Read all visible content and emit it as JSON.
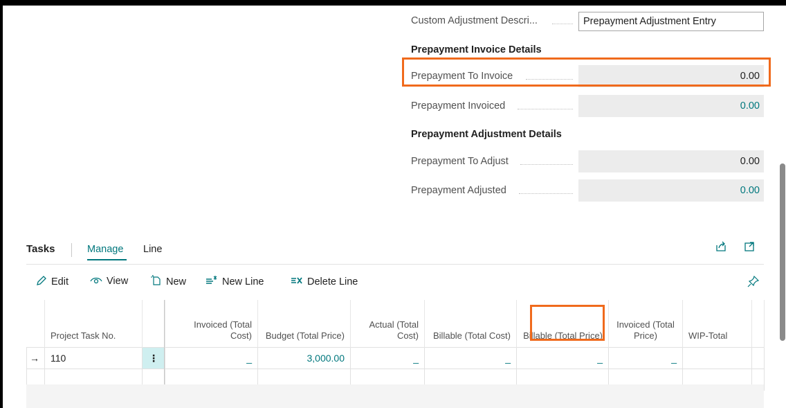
{
  "general": {
    "custom_adjustment_label": "Custom Adjustment Descri...",
    "custom_adjustment_value": "Prepayment Adjustment Entry"
  },
  "prepayment_invoice": {
    "heading": "Prepayment Invoice Details",
    "to_invoice_label": "Prepayment To Invoice",
    "to_invoice_value": "0.00",
    "invoiced_label": "Prepayment Invoiced",
    "invoiced_value": "0.00"
  },
  "prepayment_adjustment": {
    "heading": "Prepayment Adjustment Details",
    "to_adjust_label": "Prepayment To Adjust",
    "to_adjust_value": "0.00",
    "adjusted_label": "Prepayment Adjusted",
    "adjusted_value": "0.00"
  },
  "tasks": {
    "title": "Tasks",
    "tabs": [
      "Manage",
      "Line"
    ],
    "actions": {
      "edit": "Edit",
      "view": "View",
      "new": "New",
      "new_line": "New Line",
      "delete_line": "Delete Line"
    },
    "columns": {
      "project_task_no": "Project Task No.",
      "invoiced_total_cost": "Invoiced (Total Cost)",
      "budget_total_price": "Budget (Total Price)",
      "actual_total_cost": "Actual (Total Cost)",
      "billable_total_cost": "Billable (Total Cost)",
      "billable_total_price": "Billable (Total Price)",
      "invoiced_total_price": "Invoiced (Total Price)",
      "wip_total": "WIP-Total"
    },
    "rows": [
      {
        "task_no": "110",
        "invoiced_total_cost": "_",
        "budget_total_price": "3,000.00",
        "actual_total_cost": "_",
        "billable_total_cost": "_",
        "billable_total_price": "_",
        "invoiced_total_price": "_",
        "wip_total": ""
      }
    ]
  },
  "icons": {
    "share": "share-icon",
    "expand": "expand-icon",
    "pin": "pin-icon"
  },
  "colors": {
    "accent": "#00777d",
    "highlight": "#f06a1c"
  }
}
